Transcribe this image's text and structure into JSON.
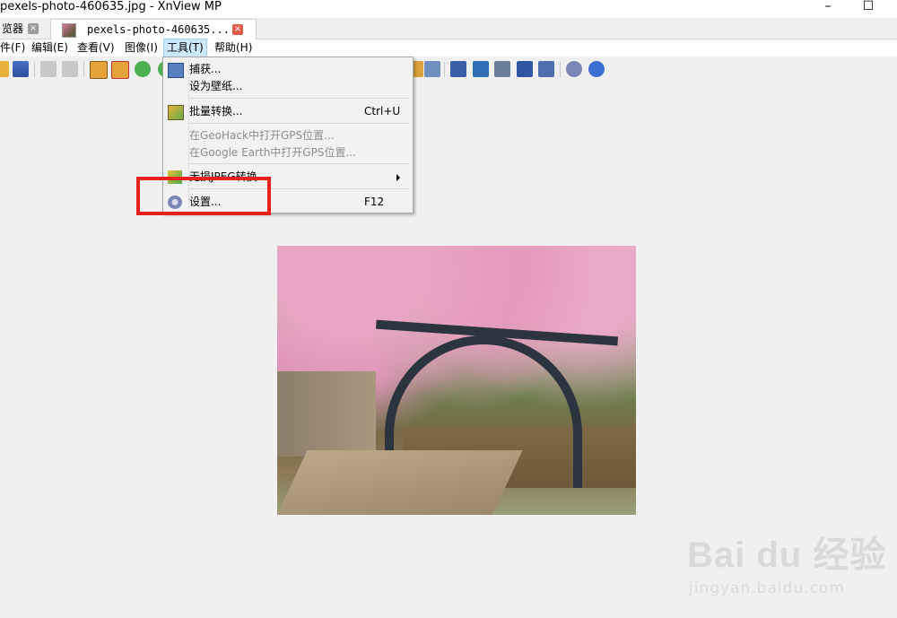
{
  "window": {
    "title": "pexels-photo-460635.jpg - XnView MP",
    "minimize_glyph": "–",
    "maximize_glyph": "☐"
  },
  "tabs": [
    {
      "label": "览器",
      "active": false
    },
    {
      "label": "pexels-photo-460635....",
      "active": true
    }
  ],
  "menubar": [
    {
      "label": "件(F)"
    },
    {
      "label": "编辑(E)"
    },
    {
      "label": "查看(V)"
    },
    {
      "label": "图像(I)"
    },
    {
      "label": "工具(T)",
      "active": true
    },
    {
      "label": "帮助(H)"
    }
  ],
  "tools_menu": {
    "items": [
      {
        "label": "捕获...",
        "shortcut": "",
        "disabled": false,
        "icon": "capture-icon"
      },
      {
        "label": "设为壁纸...",
        "shortcut": "",
        "disabled": false,
        "icon": ""
      },
      {
        "label": "批量转换...",
        "shortcut": "Ctrl+U",
        "disabled": false,
        "icon": "batch-convert-icon"
      },
      {
        "label": "在GeoHack中打开GPS位置...",
        "shortcut": "",
        "disabled": true,
        "icon": ""
      },
      {
        "label": "在Google Earth中打开GPS位置...",
        "shortcut": "",
        "disabled": true,
        "icon": ""
      },
      {
        "label": "无损JPEG转换",
        "shortcut": "",
        "disabled": false,
        "icon": "jpeg-transform-icon",
        "submenu": true
      },
      {
        "label": "设置...",
        "shortcut": "F12",
        "disabled": false,
        "icon": "gear-icon"
      }
    ]
  },
  "watermark": {
    "brand": "Bai du 经验",
    "url": "jingyan.baidu.com"
  },
  "colors": {
    "highlight_box": "#e8211d",
    "menu_active_bg": "#cce8ff",
    "tab_close_red": "#e05a4a"
  }
}
